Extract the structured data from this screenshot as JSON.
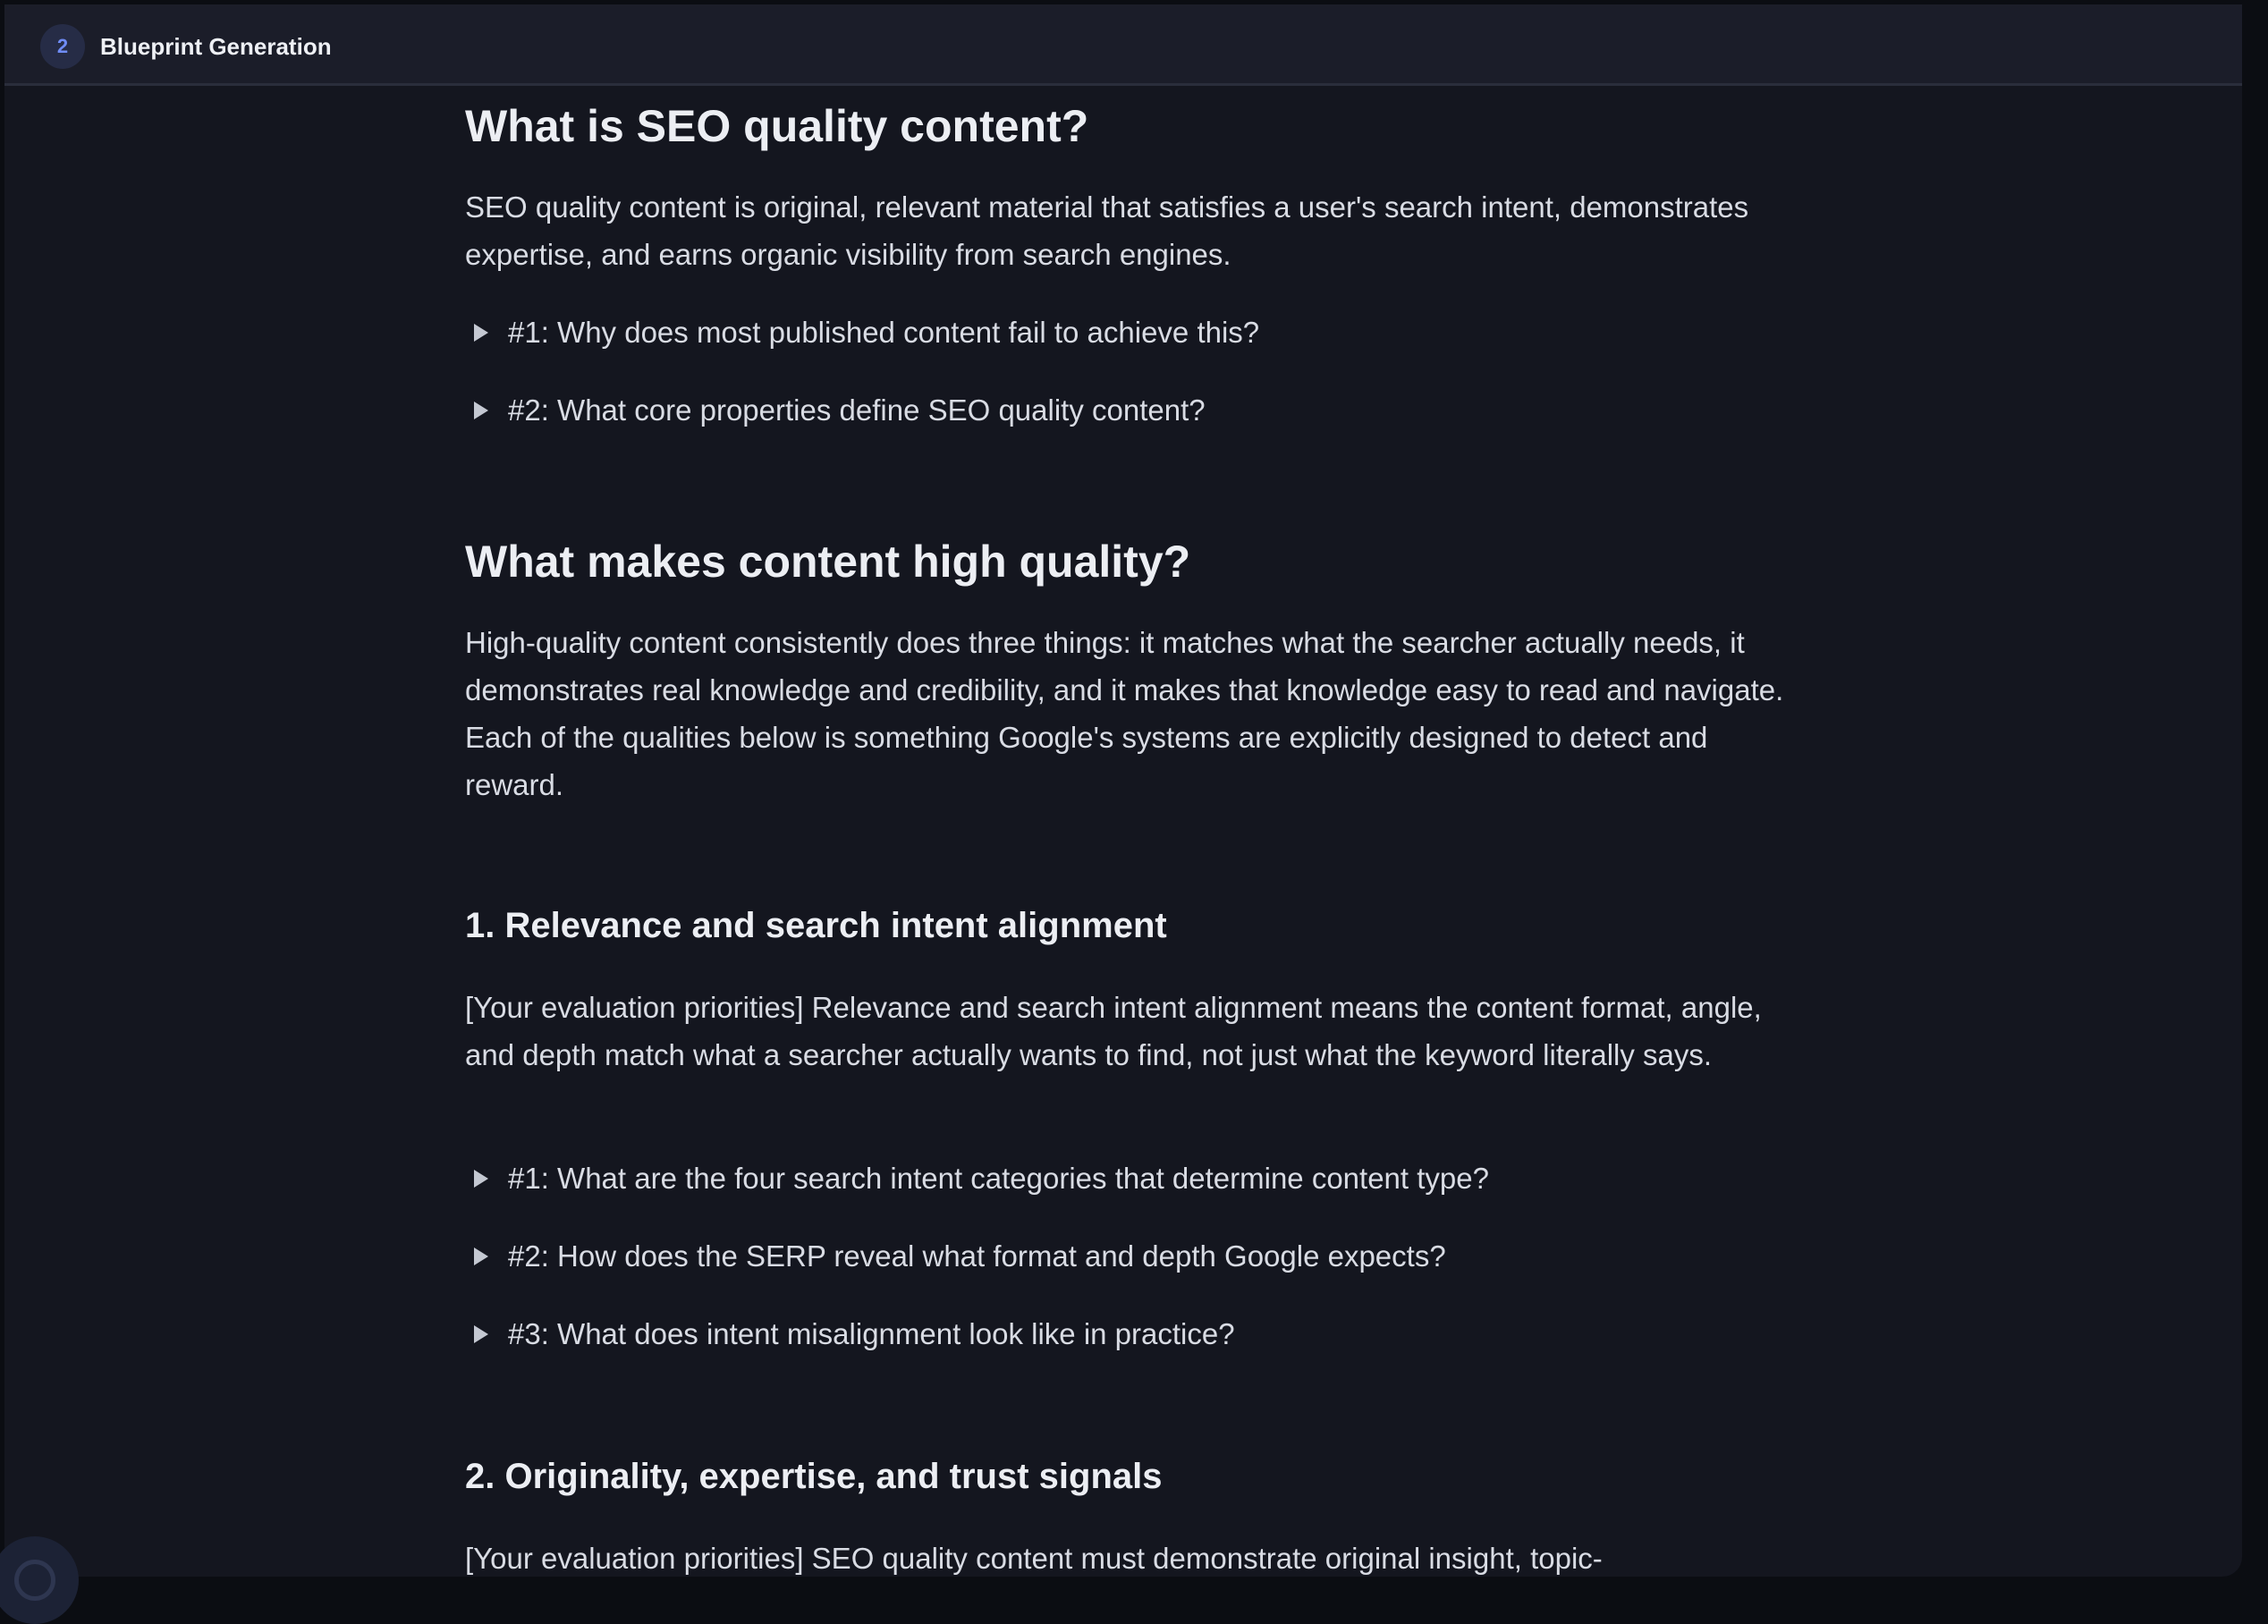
{
  "window": {
    "step_number": "2",
    "title": "Blueprint Generation"
  },
  "article": {
    "section1": {
      "heading": "What is SEO quality content?",
      "paragraph": "SEO quality content is original, relevant material that satisfies a user's search intent, demonstrates expertise, and earns organic visibility from search engines.",
      "faqs": [
        "#1: Why does most published content fail to achieve this?",
        "#2: What core properties define SEO quality content?"
      ]
    },
    "section2": {
      "heading": "What makes content high quality?",
      "paragraph": "High-quality content consistently does three things: it matches what the searcher actually needs, it demonstrates real knowledge and credibility, and it makes that knowledge easy to read and navigate. Each of the qualities below is something Google's systems are explicitly designed to detect and reward."
    },
    "subsection1": {
      "heading": "1. Relevance and search intent alignment",
      "paragraph": "[Your evaluation priorities] Relevance and search intent alignment means the content format, angle, and depth match what a searcher actually wants to find, not just what the keyword literally says.",
      "faqs": [
        "#1: What are the four search intent categories that determine content type?",
        "#2: How does the SERP reveal what format and depth Google expects?",
        "#3: What does intent misalignment look like in practice?"
      ]
    },
    "subsection2": {
      "heading": "2. Originality, expertise, and trust signals",
      "paragraph": "[Your evaluation priorities] SEO quality content must demonstrate original insight, topic-"
    }
  },
  "icons": {
    "faq_toggle": "triangle-right-icon",
    "avatar": "user-avatar-icon"
  },
  "colors": {
    "background": "#14161f",
    "titlebar": "#1b1d29",
    "accent": "#6f8cf5",
    "text": "#d9dce4",
    "heading": "#eceef3"
  }
}
